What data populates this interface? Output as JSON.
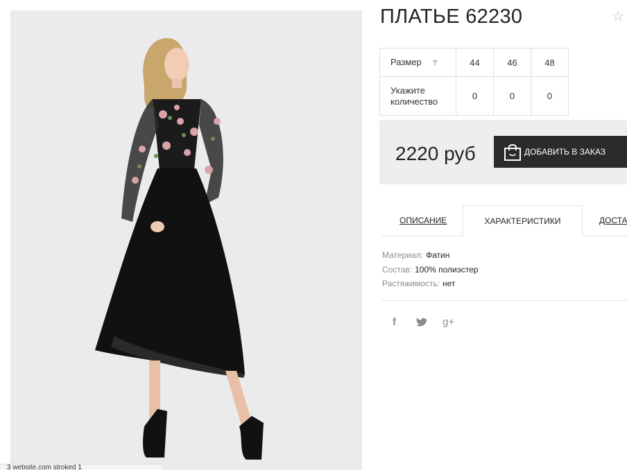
{
  "product": {
    "title": "ПЛАТЬЕ 62230",
    "favorite_icon": "☆"
  },
  "sizes": {
    "size_label": "Размер",
    "help": "?",
    "quantity_label_line1": "Укажите",
    "quantity_label_line2": "количество",
    "columns": [
      "44",
      "46",
      "48"
    ],
    "quantities": [
      "0",
      "0",
      "0"
    ]
  },
  "purchase": {
    "price": "2220 руб",
    "add_button": "ДОБАВИТЬ В ЗАКАЗ"
  },
  "tabs": {
    "description": "ОПИСАНИЕ",
    "characteristics": "ХАРАКТЕРИСТИКИ",
    "delivery": "ДОСТАВКА",
    "active": "characteristics"
  },
  "specs": [
    {
      "key": "Материал:",
      "value": "Фатин"
    },
    {
      "key": "Состав:",
      "value": "100% полиэстер"
    },
    {
      "key": "Растяжимость:",
      "value": "нет"
    }
  ],
  "social": {
    "facebook": "f",
    "twitter": "twitter-icon",
    "googleplus": "g+"
  },
  "status_bar": {
    "text": "3 website.com stroked 1"
  },
  "colors": {
    "button_bg": "#2b2b2b",
    "price_bar_bg": "#eeeeee",
    "photo_bg": "#ebebed"
  }
}
